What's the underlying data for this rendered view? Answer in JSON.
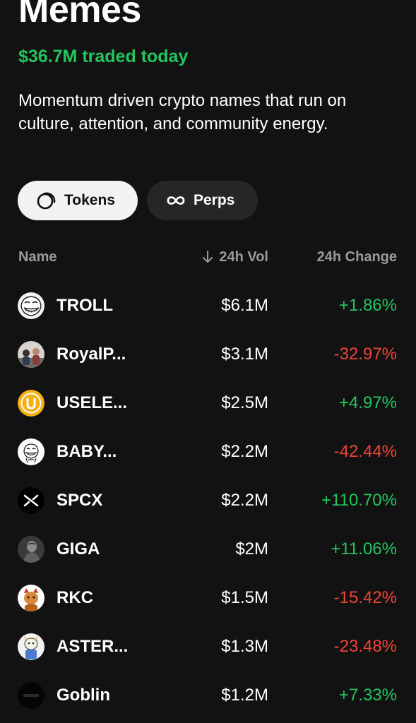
{
  "header": {
    "title": "Memes",
    "traded": "$36.7M traded today",
    "description": "Momentum driven crypto names that run on culture, attention, and community energy."
  },
  "tabs": [
    {
      "label": "Tokens",
      "icon": "circle-stack-icon",
      "active": true
    },
    {
      "label": "Perps",
      "icon": "infinity-icon",
      "active": false
    }
  ],
  "columns": {
    "name": "Name",
    "volume": "24h Vol",
    "change": "24h Change"
  },
  "tokens": [
    {
      "name": "TROLL",
      "volume": "$6.1M",
      "change": "+1.86%",
      "direction": "up"
    },
    {
      "name": "RoyalP...",
      "volume": "$3.1M",
      "change": "-32.97%",
      "direction": "down"
    },
    {
      "name": "USELE...",
      "volume": "$2.5M",
      "change": "+4.97%",
      "direction": "up"
    },
    {
      "name": "BABY...",
      "volume": "$2.2M",
      "change": "-42.44%",
      "direction": "down"
    },
    {
      "name": "SPCX",
      "volume": "$2.2M",
      "change": "+110.70%",
      "direction": "up"
    },
    {
      "name": "GIGA",
      "volume": "$2M",
      "change": "+11.06%",
      "direction": "up"
    },
    {
      "name": "RKC",
      "volume": "$1.5M",
      "change": "-15.42%",
      "direction": "down"
    },
    {
      "name": "ASTER...",
      "volume": "$1.3M",
      "change": "-23.48%",
      "direction": "down"
    },
    {
      "name": "Goblin",
      "volume": "$1.2M",
      "change": "+7.33%",
      "direction": "up"
    }
  ],
  "colors": {
    "background": "#121212",
    "positive": "#22c55e",
    "negative": "#ef4436"
  }
}
